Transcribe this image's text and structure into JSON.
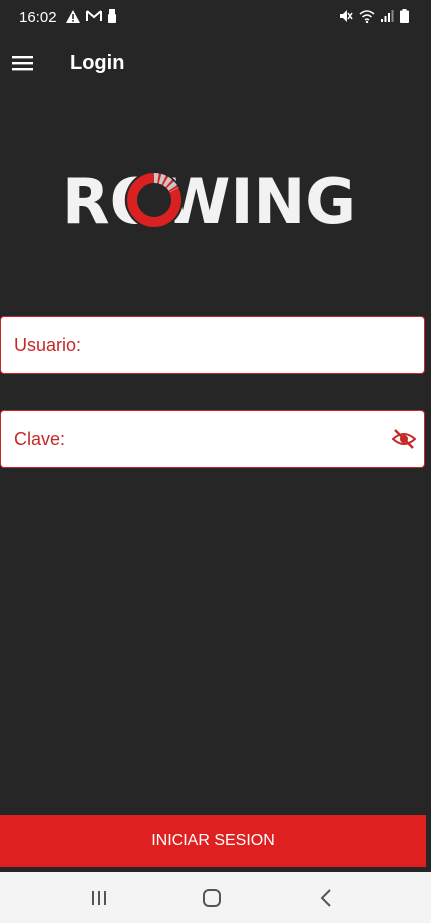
{
  "status_bar": {
    "time": "16:02",
    "left_icons": [
      "warning-icon",
      "gmail-icon",
      "usb-icon"
    ],
    "right_icons": [
      "mute-icon",
      "wifi-icon",
      "signal-icon",
      "battery-icon"
    ]
  },
  "app_bar": {
    "title": "Login",
    "menu_icon": "hamburger-menu-icon"
  },
  "logo": {
    "text": "ROWING",
    "colors": {
      "letters": "#f2f2f2",
      "ring_red": "#d92121",
      "ring_grey": "#c8c8c8"
    }
  },
  "form": {
    "username": {
      "label": "Usuario:",
      "value": ""
    },
    "password": {
      "label": "Clave:",
      "value": "",
      "toggle_icon": "eye-off-icon"
    }
  },
  "login_button": {
    "label": "INICIAR SESION"
  },
  "nav_bar": {
    "icons": [
      "recent-apps-icon",
      "home-icon",
      "back-icon"
    ]
  },
  "colors": {
    "background": "#262626",
    "accent": "#df2020",
    "field_border": "#c62828",
    "nav_bar": "#f4f4f4"
  }
}
